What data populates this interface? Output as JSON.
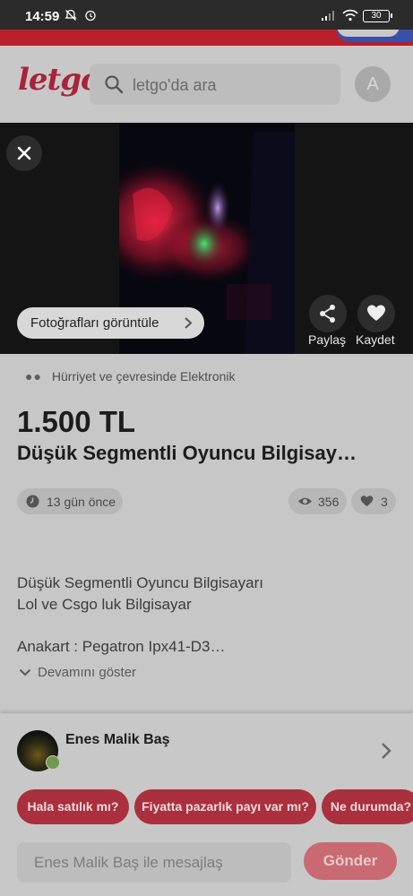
{
  "status_bar": {
    "time": "14:59",
    "battery": "30",
    "icons": [
      "bell-off-icon",
      "alarm-icon",
      "signal-icon",
      "wifi-icon",
      "battery-icon"
    ]
  },
  "header": {
    "logo": "letgo",
    "search_placeholder": "letgo'da ara",
    "avatar_initial": "A"
  },
  "photo": {
    "view_photos_label": "Fotoğrafları görüntüle",
    "share_label": "Paylaş",
    "save_label": "Kaydet"
  },
  "listing": {
    "location": "Hürriyet ve çevresinde Elektronik",
    "price": "1.500 TL",
    "title": "Düşük Segmentli Oyuncu Bilgisay…",
    "posted": "13 gün önce",
    "views": "356",
    "likes": "3",
    "description_lines": [
      "Düşük Segmentli Oyuncu Bilgisayarı",
      "Lol ve Csgo luk Bilgisayar",
      "Anakart : Pegatron Ipx41-D3…"
    ],
    "show_more": "Devamını göster"
  },
  "seller": {
    "name": "Enes Malik Baş"
  },
  "quick_replies": [
    "Hala satılık mı?",
    "Fiyatta pazarlık payı var mı?",
    "Ne durumda?"
  ],
  "message": {
    "placeholder": "Enes Malik Baş ile mesajlaş",
    "send_label": "Gönder"
  },
  "colors": {
    "brand": "#a8243b",
    "quick_reply_bg": "#a9303c",
    "send_bg": "#c96a72"
  }
}
